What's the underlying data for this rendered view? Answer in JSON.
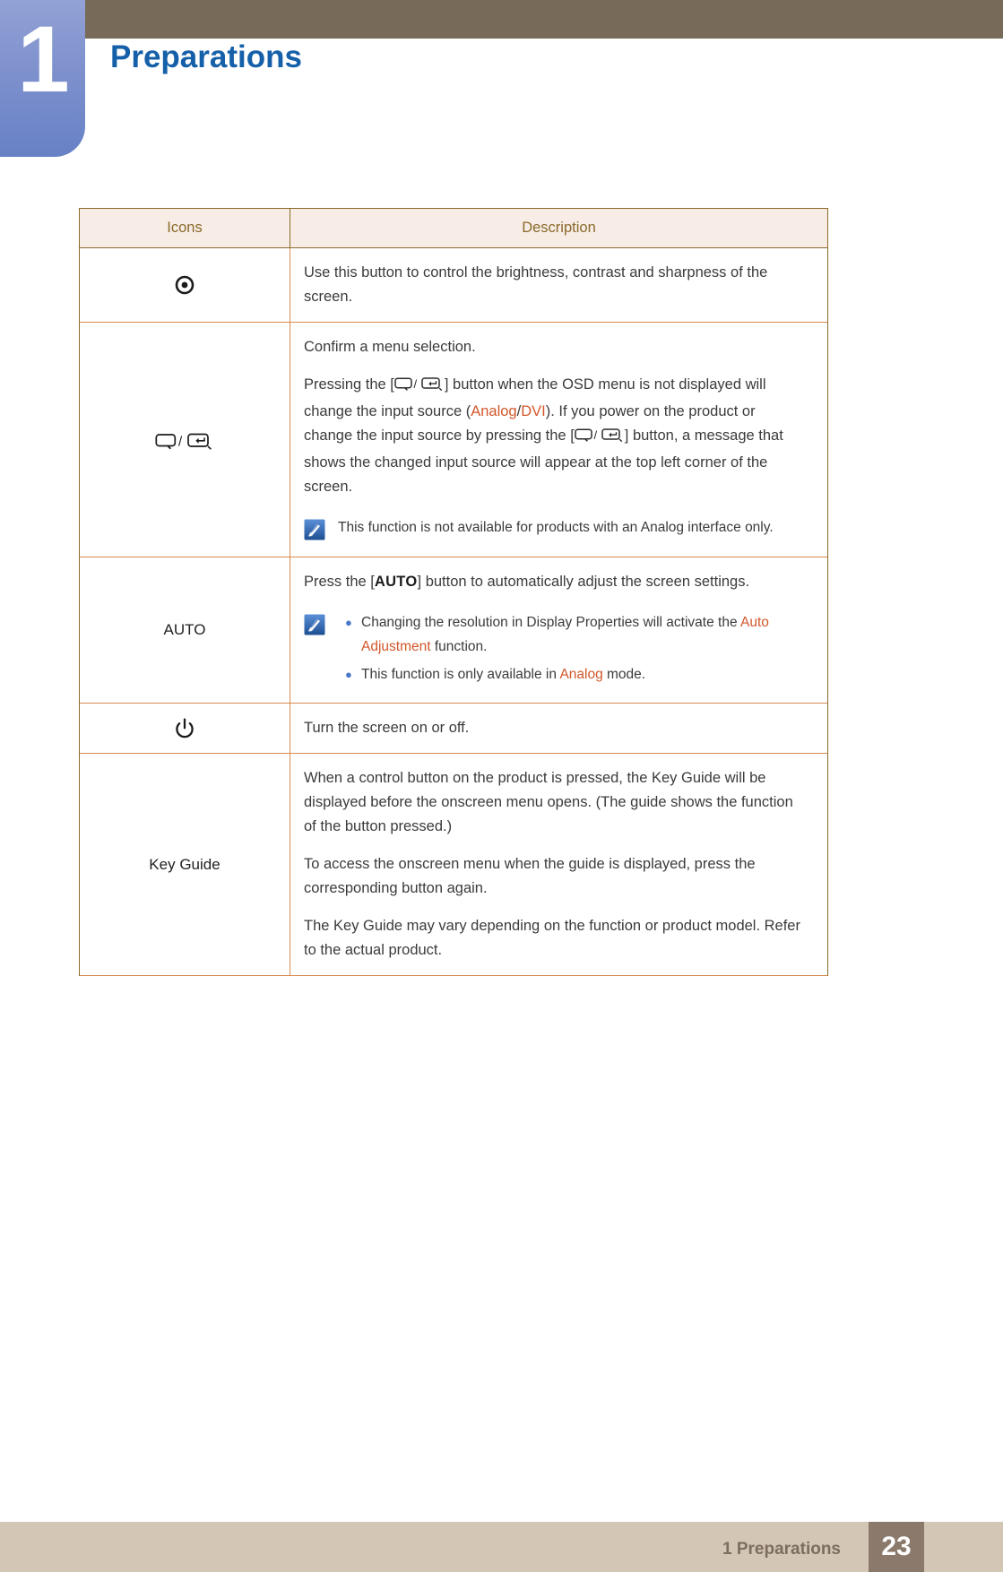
{
  "chapter": {
    "number": "1",
    "title": "Preparations"
  },
  "table": {
    "header": {
      "icons": "Icons",
      "description": "Description"
    },
    "rows": [
      {
        "icon_name": "menu-dot-icon",
        "icon_label": "",
        "paragraphs": [
          "Use this button to control the brightness, contrast and sharpness of the screen."
        ]
      },
      {
        "icon_name": "source-enter-icon",
        "icon_label": "",
        "p1": "Confirm a menu selection.",
        "p2_a": "Pressing the [",
        "p2_b": "] button when the OSD menu is not displayed will change the input source (",
        "p2_analog": "Analog",
        "p2_slash": "/",
        "p2_dvi": "DVI",
        "p2_c": "). If you power on the product or change the input source by pressing the [",
        "p2_d": "] button, a message that shows the changed input source will appear at the top left corner of the screen.",
        "note": "This function is not available for products with an Analog interface only."
      },
      {
        "icon_name": "auto-button-icon",
        "icon_label": "AUTO",
        "p1_a": "Press the [",
        "p1_auto": "AUTO",
        "p1_b": "] button to automatically adjust the screen settings.",
        "bullets": [
          {
            "a": "Changing the resolution in Display Properties will activate the ",
            "hl": "Auto Adjustment",
            "b": " function."
          },
          {
            "a": "This function is only available in ",
            "hl": "Analog",
            "b": " mode."
          }
        ]
      },
      {
        "icon_name": "power-icon",
        "icon_label": "",
        "paragraphs": [
          "Turn the screen on or off."
        ]
      },
      {
        "icon_name": "key-guide-label",
        "icon_label": "Key Guide",
        "paragraphs": [
          "When a control button on the product is pressed, the Key Guide will be displayed before the onscreen menu opens. (The guide shows the function of the button pressed.)",
          "To access the onscreen menu when the guide is displayed, press the corresponding button again.",
          "The Key Guide may vary depending on the function or product model. Refer to the actual product."
        ]
      }
    ]
  },
  "footer": {
    "text": "1 Preparations",
    "page_number": "23"
  },
  "colors": {
    "chapter_title": "#1560a8",
    "badge_gradient_top": "#93a2d6",
    "badge_gradient_bottom": "#6781c6",
    "topbar": "#786a58",
    "table_header_bg": "#f7ece6",
    "table_header_text": "#8a6a2b",
    "table_border_outer": "#8c6b2a",
    "table_border_inner": "#d98a4f",
    "highlight_orange": "#d2562a",
    "footer_bar": "#d3c6b4",
    "footer_text": "#7c6d60",
    "page_badge_bg": "#8b7a6b",
    "bullet_blue": "#4a78c8"
  }
}
